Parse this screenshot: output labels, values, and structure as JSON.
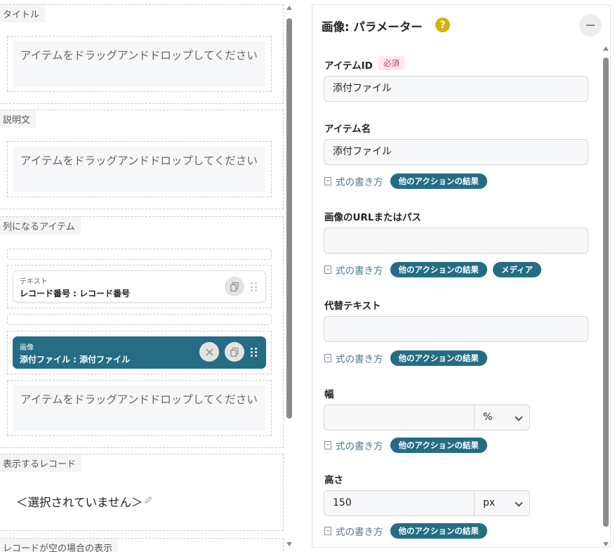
{
  "left": {
    "sections": {
      "title": {
        "label": "タイトル",
        "dropzone": "アイテムをドラッグアンドドロップしてください"
      },
      "description": {
        "label": "説明文",
        "dropzone": "アイテムをドラッグアンドドロップしてください"
      },
      "column_items": {
        "label": "列になるアイテム",
        "items": [
          {
            "type": "テキスト",
            "name": "レコード番号 : レコード番号"
          },
          {
            "type": "画像",
            "name": "添付ファイル : 添付ファイル"
          }
        ],
        "dropzone": "アイテムをドラッグアンドドロップしてください"
      },
      "record": {
        "label": "表示するレコード",
        "value": "＜選択されていません＞"
      },
      "empty": {
        "label": "レコードが空の場合の表示"
      }
    }
  },
  "panel": {
    "title": "画像: パラメーター",
    "help_glyph": "?",
    "fields": {
      "item_id": {
        "label": "アイテムID",
        "required": "必須",
        "value": "添付ファイル"
      },
      "item_name": {
        "label": "アイテム名",
        "value": "添付ファイル"
      },
      "image_url": {
        "label": "画像のURLまたはパス",
        "value": ""
      },
      "alt_text": {
        "label": "代替テキスト",
        "value": ""
      },
      "width": {
        "label": "幅",
        "value": "",
        "unit": "%"
      },
      "height": {
        "label": "高さ",
        "value": "150",
        "unit": "px"
      }
    },
    "helpers": {
      "formula_link": "式の書き方",
      "other_actions": "他のアクションの結果",
      "media": "メディア"
    }
  },
  "colors": {
    "accent": "#246d85",
    "help": "#d4b20a",
    "required_text": "#d0305a"
  },
  "icons": [
    "help-icon",
    "minus-icon",
    "copy-icon",
    "close-icon",
    "drag-handle-icon",
    "pencil-icon",
    "document-icon",
    "chevron-down-icon"
  ]
}
